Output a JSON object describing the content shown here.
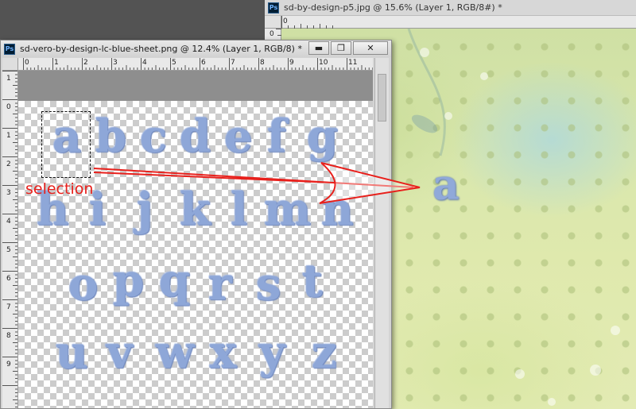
{
  "back_window": {
    "title": "sd-by-design-p5.jpg @ 15.6% (Layer 1, RGB/8#) *",
    "icon": "photoshop-icon",
    "ruler_top": [
      "0"
    ],
    "ruler_left": [
      "0"
    ],
    "pasted_letter": "a"
  },
  "front_window": {
    "title": "sd-vero-by-design-lc-blue-sheet.png @ 12.4% (Layer 1, RGB/8) *",
    "icon": "photoshop-icon",
    "buttons": {
      "minimize": "▬",
      "maximize": "❐",
      "close": "✕"
    },
    "ruler_top": [
      "0",
      "1",
      "2",
      "3",
      "4",
      "5",
      "6",
      "7",
      "8",
      "9",
      "10",
      "11"
    ],
    "ruler_left": [
      "1",
      "0",
      "1",
      "2",
      "3",
      "4",
      "5",
      "6",
      "7",
      "8",
      "9"
    ],
    "letters": {
      "row1": [
        "a",
        "b",
        "c",
        "d",
        "e",
        "f",
        "g"
      ],
      "row2": [
        "h",
        "i",
        "j",
        "k",
        "l",
        "m",
        "n"
      ],
      "row3": [
        "o",
        "p",
        "q",
        "r",
        "s",
        "t"
      ],
      "row4": [
        "u",
        "v",
        "w",
        "x",
        "y",
        "z"
      ]
    }
  },
  "annotation": {
    "label": "selection",
    "color": "#e8201c"
  },
  "badge_text": "Ps"
}
